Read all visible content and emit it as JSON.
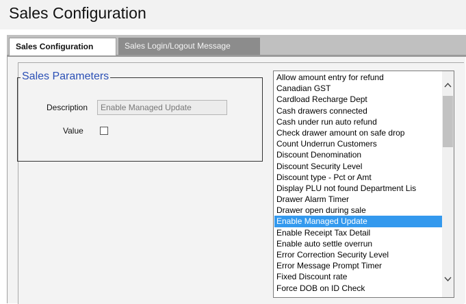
{
  "page": {
    "title": "Sales Configuration"
  },
  "tabs": [
    {
      "label": "Sales Configuration",
      "active": true
    },
    {
      "label": "Sales Login/Logout Message",
      "active": false
    }
  ],
  "parameters": {
    "legend": "Sales Parameters",
    "description_label": "Description",
    "description_value": "Enable Managed Update",
    "value_label": "Value",
    "value_checked": false
  },
  "list": {
    "selected": "Enable Managed Update",
    "items": [
      "Allow amount entry for refund",
      "Canadian GST",
      "Cardload Recharge Dept",
      "Cash drawers connected",
      "Cash under run auto refund",
      "Check drawer amount on safe drop",
      "Count Underrun Customers",
      "Discount Denomination",
      "Discount Security Level",
      "Discount type - Pct or Amt",
      "Display PLU not found Department Lis",
      "Drawer Alarm Timer",
      "Drawer open during sale",
      "Enable Managed Update",
      "Enable Receipt Tax Detail",
      "Enable auto settle overrun",
      "Error Correction Security Level",
      "Error Message Prompt Timer",
      "Fixed Discount rate",
      "Force DOB on ID Check"
    ]
  },
  "colors": {
    "selection": "#3399ee",
    "legend": "#2a4fb5"
  },
  "icons": {
    "scroll_up": "chevron-up-icon",
    "scroll_down": "chevron-down-icon"
  }
}
